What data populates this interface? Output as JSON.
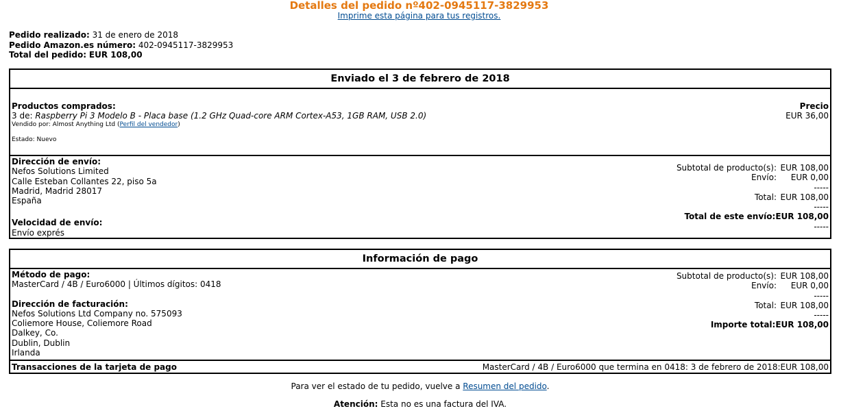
{
  "header": {
    "title": "Detalles del pedido nº402-0945117-3829953",
    "print_link": "Imprime esta página para tus registros."
  },
  "summary": {
    "placed_label": "Pedido realizado:",
    "placed_value": "31 de enero de 2018",
    "number_label": "Pedido Amazon.es número:",
    "number_value": "402-0945117-3829953",
    "total_label": "Total del pedido:",
    "total_value": "EUR 108,00"
  },
  "shipment": {
    "heading": "Enviado el 3 de febrero de 2018",
    "products_label": "Productos comprados:",
    "price_label": "Precio",
    "qty_prefix": "3 de: ",
    "product_name": "Raspberry Pi 3 Modelo B - Placa base (1.2 GHz Quad-core ARM Cortex-A53, 1GB RAM, USB 2.0)",
    "product_price": "EUR 36,00",
    "sold_by": "Vendido por: Almost Anything Ltd (",
    "seller_link": "Perfil del vendedor",
    "sold_by_end": ")",
    "condition": "Estado: Nuevo",
    "address_label": "Dirección de envío:",
    "address_lines": [
      "Nefos Solutions Limited",
      "Calle Esteban Collantes 22, piso 5a",
      "Madrid, Madrid 28017",
      "España"
    ],
    "speed_label": "Velocidad de envío:",
    "speed_value": "Envío exprés",
    "subtotal_label": "Subtotal de producto(s):",
    "subtotal_value": "EUR 108,00",
    "shipping_label": "Envío:",
    "shipping_value": "EUR 0,00",
    "dashes": "-----",
    "total_label": "Total:",
    "total_value": "EUR 108,00",
    "grand_label": "Total de este envío:",
    "grand_value": "EUR 108,00"
  },
  "payment": {
    "heading": "Información de pago",
    "method_label": "Método de pago:",
    "method_value": "MasterCard / 4B / Euro6000 | Últimos dígitos: 0418",
    "billing_label": "Dirección de facturación:",
    "billing_lines": [
      "Nefos Solutions Ltd Company no. 575093",
      "Coliemore House, Coliemore Road",
      "Dalkey, Co.",
      "Dublin, Dublin",
      "Irlanda"
    ],
    "subtotal_label": "Subtotal de producto(s):",
    "subtotal_value": "EUR 108,00",
    "shipping_label": "Envío:",
    "shipping_value": "EUR 0,00",
    "dashes": "-----",
    "total_label": "Total:",
    "total_value": "EUR 108,00",
    "grand_label": "Importe total:",
    "grand_value": "EUR 108,00",
    "transactions_label": "Transacciones de la tarjeta de pago",
    "transactions_value": "MasterCard / 4B / Euro6000 que termina en 0418: 3 de febrero de 2018:EUR 108,00"
  },
  "footer": {
    "status_text": "Para ver el estado de tu pedido, vuelve a ",
    "status_link": "Resumen del pedido",
    "status_end": ".",
    "note_label": "Atención:",
    "note_text": " Esta no es una factura del IVA."
  }
}
